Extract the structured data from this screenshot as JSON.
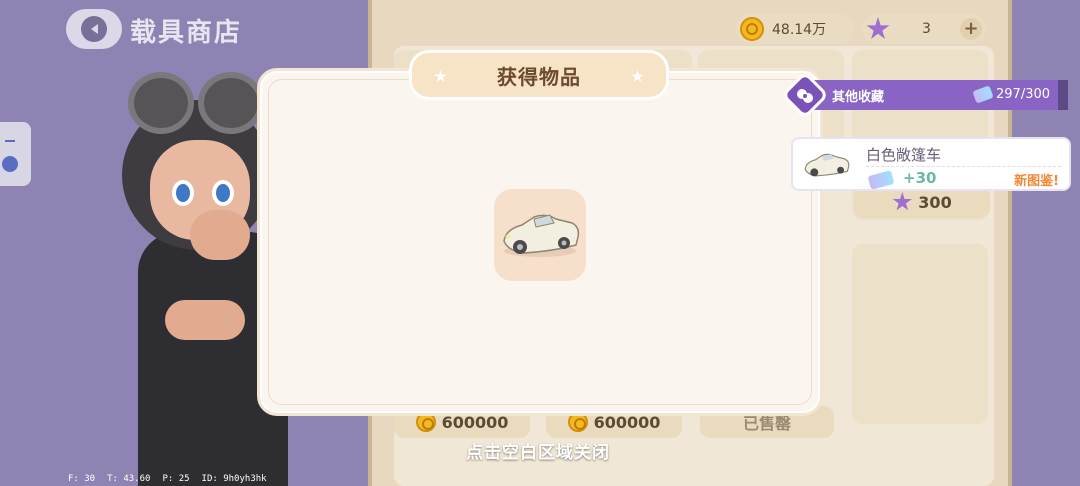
{
  "header": {
    "title": "载具商店"
  },
  "currency": {
    "coins": "48.14万",
    "stars": "3",
    "add_label": "+"
  },
  "shop": {
    "star_price": "300",
    "bottom_prices": [
      "600000",
      "600000"
    ],
    "sold_label": "已售罄"
  },
  "modal": {
    "title": "获得物品",
    "item_icon": "white-convertible-car-icon",
    "close_hint": "点击空白区域关闭"
  },
  "collection": {
    "label": "其他收藏",
    "progress": "297/300",
    "progress_value": 0.99
  },
  "notification": {
    "item_name": "白色敞篷车",
    "points": "+30",
    "new_label": "新图鉴!"
  },
  "debug": {
    "f": "F: 30",
    "t": "T: 43.60",
    "p": "P: 25",
    "id": "ID: 9h0yh3hk"
  },
  "colors": {
    "background": "#8e83b2",
    "modal": "#faf6ef",
    "title_tab": "#f7e3c6",
    "accent_purple": "#8a64c4",
    "coin_gold": "#f2b922",
    "new_orange": "#f08a3a"
  }
}
